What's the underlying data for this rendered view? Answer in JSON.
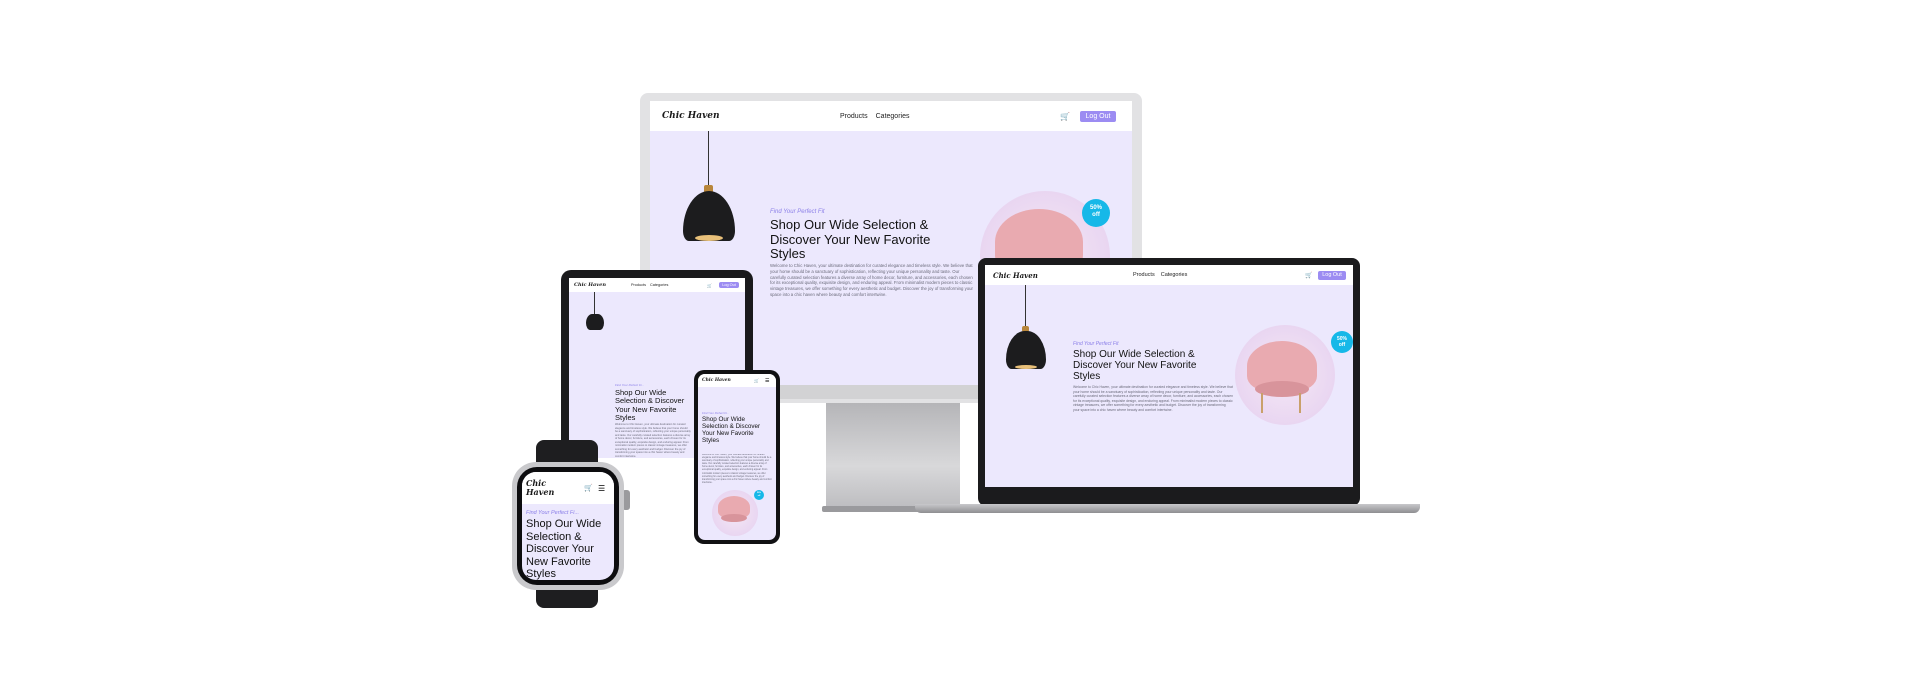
{
  "site": {
    "logo": "Chic Haven",
    "logo_watch_line1": "Chic",
    "logo_watch_line2": "Haven",
    "nav": [
      "Products",
      "Categories"
    ],
    "logout": "Log Out",
    "eyebrow": "Find Your Perfect Fit",
    "eyebrow_short": "Find Your Perfect Fi...",
    "heading": "Shop Our Wide Selection & Discover Your New Favorite Styles",
    "paragraph": "Welcome to Chic Haven, your ultimate destination for curated elegance and timeless style. We believe that your home should be a sanctuary of sophistication, reflecting your unique personality and taste. Our carefully curated selection features a diverse array of home decor, furniture, and accessories, each chosen for its exceptional quality, exquisite design, and enduring appeal. From minimalist modern pieces to classic vintage treasures, we offer something for every aesthetic and budget. Discover the joy of transforming your space into a chic haven where beauty and comfort intertwine.",
    "badge_line1": "50%",
    "badge_line2": "off"
  },
  "icons": {
    "cart": "cart-icon",
    "menu": "hamburger-menu-icon"
  },
  "colors": {
    "accent": "#9c8cf2",
    "background": "#ece8fd",
    "badge": "#16b8e8"
  }
}
